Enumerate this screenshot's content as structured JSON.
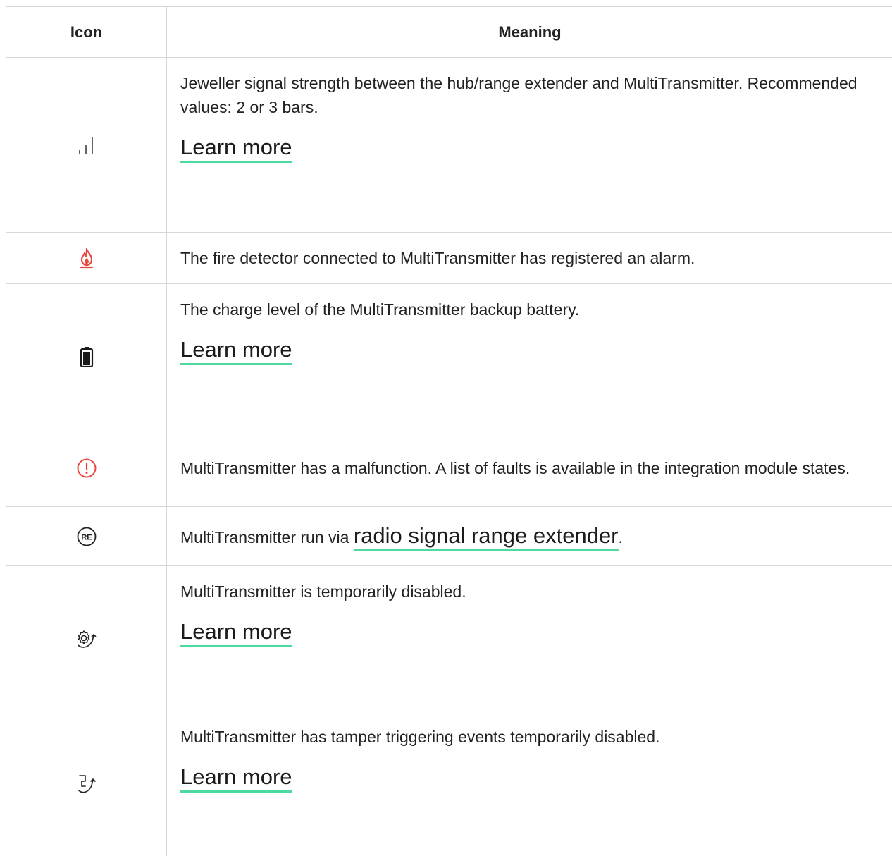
{
  "header": {
    "icon_col": "Icon",
    "meaning_col": "Meaning"
  },
  "rows": [
    {
      "icon": "signal-strength-icon",
      "text": "Jeweller signal strength between the hub/range extender and MultiTransmitter. Recommended values: 2 or 3 bars.",
      "link": "Learn more"
    },
    {
      "icon": "fire-alarm-icon",
      "text": "The fire detector connected to MultiTransmitter has registered an alarm."
    },
    {
      "icon": "battery-icon",
      "text": "The charge level of the MultiTransmitter backup battery.",
      "link": "Learn more"
    },
    {
      "icon": "malfunction-icon",
      "text": "MultiTransmitter has a malfunction. A list of faults is available in the integration module states."
    },
    {
      "icon": "range-extender-icon",
      "text_before": "MultiTransmitter run via ",
      "link": "radio signal range extender",
      "text_after": "."
    },
    {
      "icon": "temporarily-disabled-icon",
      "text": "MultiTransmitter is temporarily disabled.",
      "link": "Learn more"
    },
    {
      "icon": "tamper-disabled-icon",
      "text": "MultiTransmitter has tamper triggering events temporarily disabled.",
      "link": "Learn more"
    }
  ],
  "colors": {
    "accent_underline": "#4ed9a0",
    "alert_red": "#e8473d",
    "border": "#d6d6d6"
  }
}
